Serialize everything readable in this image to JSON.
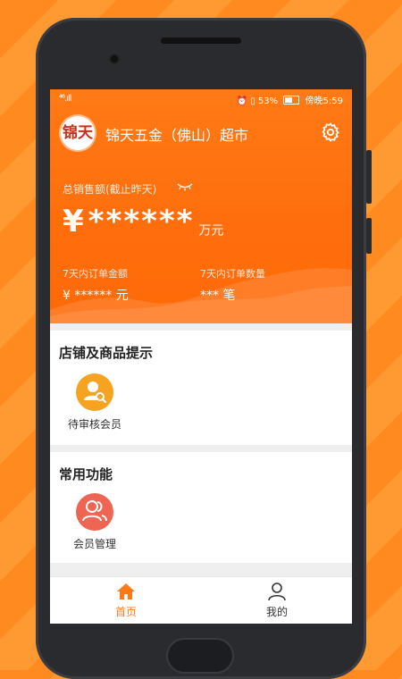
{
  "status_bar": {
    "signal": "⁴⁶.ıll",
    "right_text": "⏰ ▯ 53%",
    "time": "傍晚5:59"
  },
  "header": {
    "logo_text": "锦天",
    "store_name": "锦天五金（佛山）超市"
  },
  "sales": {
    "label": "总销售额(截止昨天)",
    "currency": "¥",
    "masked_value": "******",
    "unit": "万元"
  },
  "stats": {
    "amount_label": "7天内订单金额",
    "amount_value": "¥ ****** 元",
    "count_label": "7天内订单数量",
    "count_value": "*** 笔"
  },
  "sections": {
    "tips_title": "店铺及商品提示",
    "tips_item": "待审核会员",
    "common_title": "常用功能",
    "common_item": "会员管理"
  },
  "tabbar": {
    "home_label": "首页",
    "mine_label": "我的"
  },
  "colors": {
    "accent": "#ff7a16",
    "gold": "#f6a321",
    "red": "#ee6553"
  }
}
